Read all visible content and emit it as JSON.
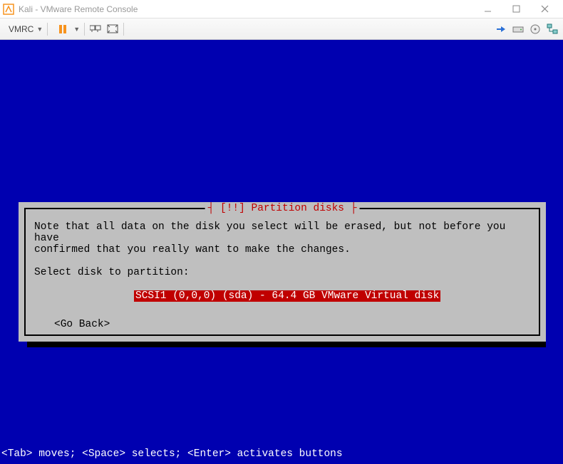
{
  "window": {
    "title": "Kali - VMware Remote Console"
  },
  "toolbar": {
    "dropdown_label": "VMRC"
  },
  "installer": {
    "dialog_title": "[!!] Partition disks",
    "note_line1": "Note that all data on the disk you select will be erased, but not before you have",
    "note_line2": "confirmed that you really want to make the changes.",
    "prompt": "Select disk to partition:",
    "selected_disk": "SCSI1 (0,0,0) (sda) - 64.4 GB VMware Virtual disk",
    "go_back": "<Go Back>",
    "help_text": "<Tab> moves; <Space> selects; <Enter> activates buttons"
  }
}
